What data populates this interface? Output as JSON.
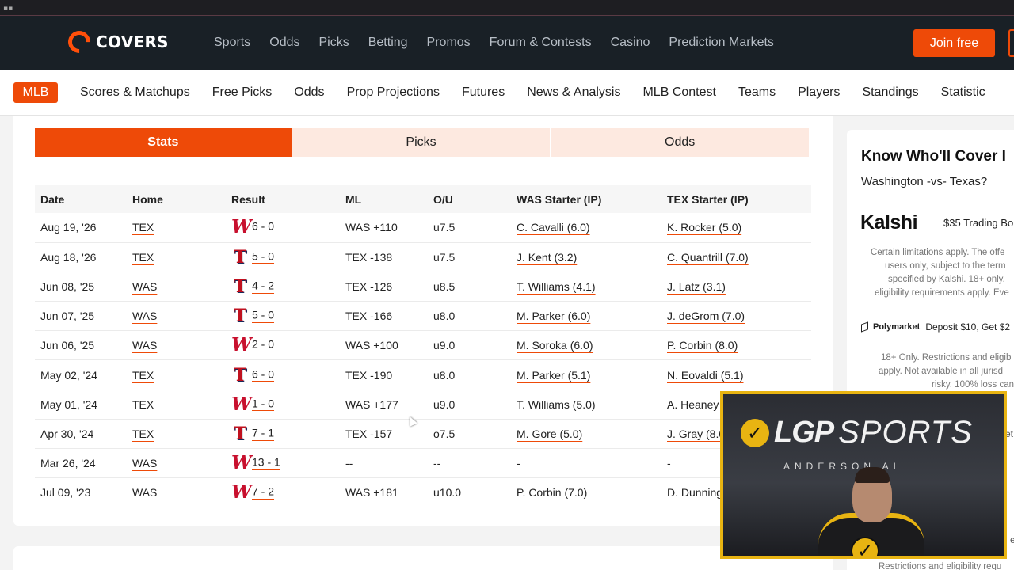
{
  "header": {
    "logo_text": "COVERS",
    "nav": [
      "Sports",
      "Odds",
      "Picks",
      "Betting",
      "Promos",
      "Forum & Contests",
      "Casino",
      "Prediction Markets"
    ],
    "join_label": "Join free"
  },
  "subnav": {
    "active": "MLB",
    "items": [
      "Scores & Matchups",
      "Free Picks",
      "Odds",
      "Prop Projections",
      "Futures",
      "News & Analysis",
      "MLB Contest",
      "Teams",
      "Players",
      "Standings",
      "Statistic"
    ]
  },
  "tabs": [
    "Stats",
    "Picks",
    "Odds"
  ],
  "table": {
    "headers": [
      "Date",
      "Home",
      "Result",
      "ML",
      "O/U",
      "WAS Starter (IP)",
      "TEX Starter (IP)"
    ],
    "rows": [
      {
        "date": "Aug 19, '26",
        "home": "TEX",
        "winner": "W",
        "score": "6 - 0",
        "ml": "WAS +110",
        "ou": "u7.5",
        "was_starter": "C. Cavalli (6.0)",
        "tex_starter": "K. Rocker (5.0)"
      },
      {
        "date": "Aug 18, '26",
        "home": "TEX",
        "winner": "T",
        "score": "5 - 0",
        "ml": "TEX -138",
        "ou": "u7.5",
        "was_starter": "J. Kent (3.2)",
        "tex_starter": "C. Quantrill (7.0)"
      },
      {
        "date": "Jun 08, '25",
        "home": "WAS",
        "winner": "T",
        "score": "4 - 2",
        "ml": "TEX -126",
        "ou": "u8.5",
        "was_starter": "T. Williams (4.1)",
        "tex_starter": "J. Latz (3.1)"
      },
      {
        "date": "Jun 07, '25",
        "home": "WAS",
        "winner": "T",
        "score": "5 - 0",
        "ml": "TEX -166",
        "ou": "u8.0",
        "was_starter": "M. Parker (6.0)",
        "tex_starter": "J. deGrom (7.0)"
      },
      {
        "date": "Jun 06, '25",
        "home": "WAS",
        "winner": "W",
        "score": "2 - 0",
        "ml": "WAS +100",
        "ou": "u9.0",
        "was_starter": "M. Soroka (6.0)",
        "tex_starter": "P. Corbin (8.0)"
      },
      {
        "date": "May 02, '24",
        "home": "TEX",
        "winner": "T",
        "score": "6 - 0",
        "ml": "TEX -190",
        "ou": "u8.0",
        "was_starter": "M. Parker (5.1)",
        "tex_starter": "N. Eovaldi (5.1)"
      },
      {
        "date": "May 01, '24",
        "home": "TEX",
        "winner": "W",
        "score": "1 - 0",
        "ml": "WAS +177",
        "ou": "u9.0",
        "was_starter": "T. Williams (5.0)",
        "tex_starter": "A. Heaney"
      },
      {
        "date": "Apr 30, '24",
        "home": "TEX",
        "winner": "T",
        "score": "7 - 1",
        "ml": "TEX -157",
        "ou": "o7.5",
        "was_starter": "M. Gore (5.0)",
        "tex_starter": "J. Gray (8.0"
      },
      {
        "date": "Mar 26, '24",
        "home": "WAS",
        "winner": "W",
        "score": "13 - 1",
        "ml": "--",
        "ou": "--",
        "was_starter": "-",
        "tex_starter": "-"
      },
      {
        "date": "Jul 09, '23",
        "home": "WAS",
        "winner": "W",
        "score": "7 - 2",
        "ml": "WAS +181",
        "ou": "u10.0",
        "was_starter": "P. Corbin (7.0)",
        "tex_starter": "D. Dunning"
      }
    ]
  },
  "sidebar": {
    "heading": "Know Who'll Cover I",
    "matchup": "Washington -vs- Texas?",
    "kalshi_brand": "Kalshi",
    "kalshi_offer": "$35 Trading Bo",
    "kalshi_fine": [
      "Certain limitations apply. The offe",
      "users only, subject to the term",
      "specified by Kalshi. 18+ only.",
      "eligibility requirements apply. Eve"
    ],
    "poly_brand": "Polymarket",
    "poly_offer": "Deposit $10, Get $2",
    "poly_fine": [
      "18+ Only. Restrictions and eligib",
      "apply. Not available in all jurisd",
      "risky. 100% loss can o"
    ],
    "bottom_fine": "Restrictions and eligibility requ",
    "peek_1": "et",
    "peek_2": "e"
  },
  "webcam": {
    "brand_lgp": "LGP",
    "brand_sports": "SPORTS",
    "tagline": "ANDERSON    AL"
  }
}
